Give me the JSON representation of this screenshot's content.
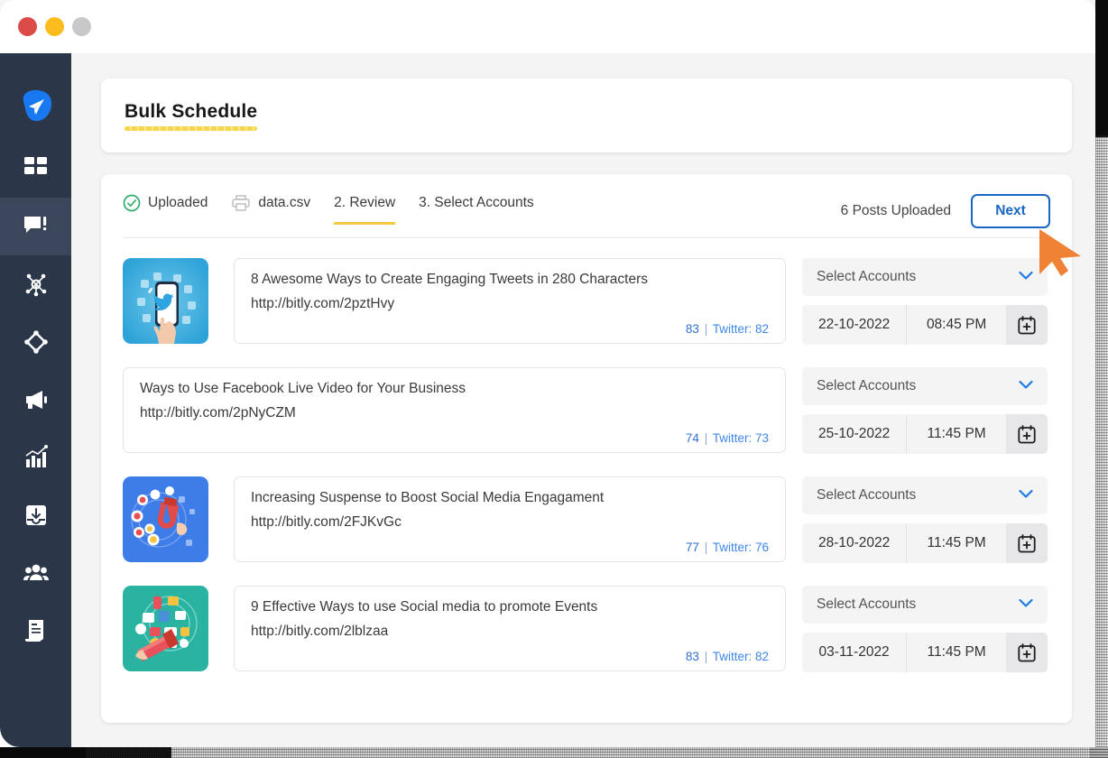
{
  "window": {
    "controls": [
      {
        "name": "close",
        "color": "#dc4b47"
      },
      {
        "name": "minimize",
        "color": "#fcbc1d"
      },
      {
        "name": "maximize",
        "color": "#c8c8c8"
      }
    ]
  },
  "sidebar": {
    "brand_icon": "paper-plane-send-icon",
    "brand_color": "#1878f0",
    "items": [
      {
        "icon": "dashboard-grid-icon",
        "name": "dashboard",
        "active": false
      },
      {
        "icon": "compose-message-icon",
        "name": "compose",
        "active": true
      },
      {
        "icon": "network-share-icon",
        "name": "network",
        "active": false
      },
      {
        "icon": "diamond-nodes-icon",
        "name": "automation",
        "active": false
      },
      {
        "icon": "megaphone-icon",
        "name": "campaigns",
        "active": false
      },
      {
        "icon": "analytics-chart-icon",
        "name": "analytics",
        "active": false
      },
      {
        "icon": "inbox-download-icon",
        "name": "inbox",
        "active": false
      },
      {
        "icon": "team-users-icon",
        "name": "team",
        "active": false
      },
      {
        "icon": "report-document-icon",
        "name": "reports",
        "active": false
      }
    ]
  },
  "header": {
    "title": "Bulk Schedule",
    "underline_color": "#f6d54a"
  },
  "steps": [
    {
      "id": "uploaded",
      "label": "Uploaded",
      "icon": "check-circle-icon",
      "active": false
    },
    {
      "id": "file",
      "label": "data.csv",
      "icon": "printer-file-icon",
      "active": false
    },
    {
      "id": "review",
      "label": "2. Review",
      "icon": "",
      "active": true
    },
    {
      "id": "select-accounts",
      "label": "3. Select Accounts",
      "icon": "",
      "active": false
    }
  ],
  "toolbar": {
    "posts_uploaded": "6 Posts Uploaded",
    "next_label": "Next",
    "next_color": "#1867c0"
  },
  "posts": [
    {
      "thumbnail": "twitter-phone-hand-illustration",
      "has_thumbnail": true,
      "title": "8 Awesome Ways to Create Engaging Tweets in 280 Characters",
      "url": "http://bitly.com/2pztHvy",
      "count": "83",
      "separator": "|",
      "twitter": "Twitter: 82",
      "accounts_placeholder": "Select Accounts",
      "date": "22-10-2022",
      "time": "08:45 PM",
      "calendar_icon": "calendar-plus-icon"
    },
    {
      "thumbnail": "",
      "has_thumbnail": false,
      "title": "Ways to Use Facebook Live Video for Your Business",
      "url": "http://bitly.com/2pNyCZM",
      "count": "74",
      "separator": "|",
      "twitter": "Twitter: 73",
      "accounts_placeholder": "Select Accounts",
      "date": "25-10-2022",
      "time": "11:45 PM",
      "calendar_icon": "calendar-plus-icon"
    },
    {
      "thumbnail": "magnet-engagement-illustration",
      "has_thumbnail": true,
      "title": "Increasing Suspense to Boost Social Media Engagament",
      "url": "http://bitly.com/2FJKvGc",
      "count": "77",
      "separator": "|",
      "twitter": "Twitter: 76",
      "accounts_placeholder": "Select Accounts",
      "date": "28-10-2022",
      "time": "11:45 PM",
      "calendar_icon": "calendar-plus-icon"
    },
    {
      "thumbnail": "megaphone-events-illustration",
      "has_thumbnail": true,
      "title": "9 Effective Ways to use Social media to promote Events",
      "url": "http://bitly.com/2lblzaa",
      "count": "83",
      "separator": "|",
      "twitter": "Twitter: 82",
      "accounts_placeholder": "Select Accounts",
      "date": "03-11-2022",
      "time": "11:45 PM",
      "calendar_icon": "calendar-plus-icon"
    }
  ],
  "cursor": {
    "icon": "orange-arrow-cursor",
    "color": "#f08236"
  }
}
